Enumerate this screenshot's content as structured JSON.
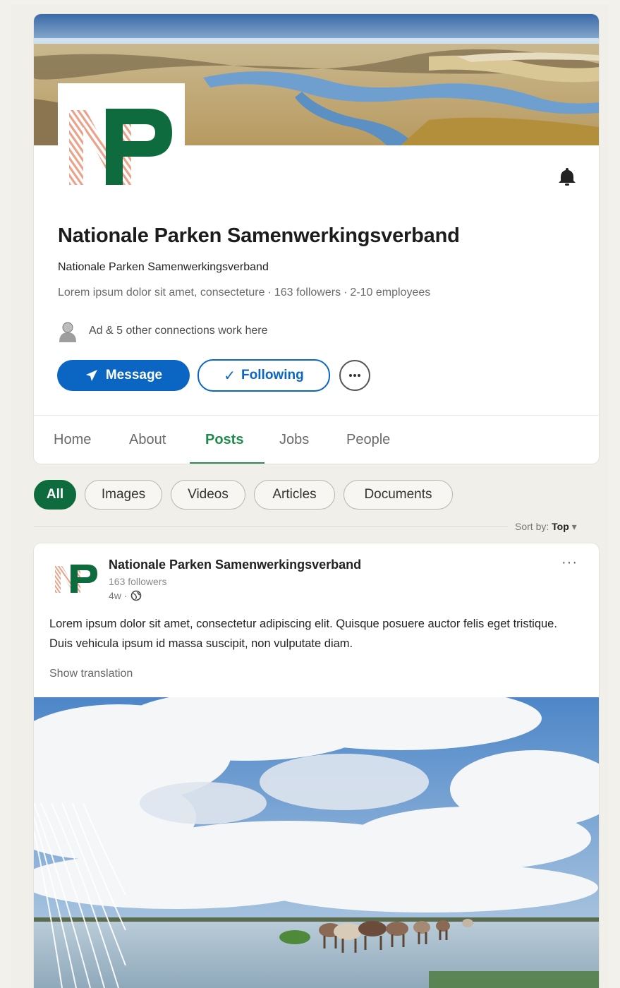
{
  "organization": {
    "name": "Nationale Parken Samenwerkingsverband",
    "subtitle": "Nationale Parken Samenwerkingsverband",
    "tagline": "Lorem ipsum dolor sit amet, consecteture",
    "followers": "163 followers",
    "employees": "2-10 employees",
    "connections_text": "Ad & 5 other connections work here"
  },
  "actions": {
    "message_label": "Message",
    "following_label": "Following"
  },
  "tabs": [
    {
      "label": "Home"
    },
    {
      "label": "About"
    },
    {
      "label": "Posts",
      "active": true
    },
    {
      "label": "Jobs"
    },
    {
      "label": "People"
    }
  ],
  "filters": [
    {
      "label": "All",
      "active": true
    },
    {
      "label": "Images"
    },
    {
      "label": "Videos"
    },
    {
      "label": "Articles"
    },
    {
      "label": "Documents"
    }
  ],
  "sort": {
    "label": "Sort by:",
    "value": "Top"
  },
  "post": {
    "author": "Nationale Parken Samenwerkingsverband",
    "followers": "163 followers",
    "age": "4w",
    "menu_label": "···",
    "body": "Lorem ipsum dolor sit amet, consectetur adipiscing elit. Quisque posuere auctor felis  eget tristique. Duis vehicula ipsum id massa suscipit, non vulputate diam.",
    "show_translation": "Show translation"
  },
  "colors": {
    "brand_green": "#0d6b3d",
    "brand_salmon": "#e8a38a",
    "link_blue": "#0a66c2",
    "tab_active": "#1f8a4c"
  }
}
